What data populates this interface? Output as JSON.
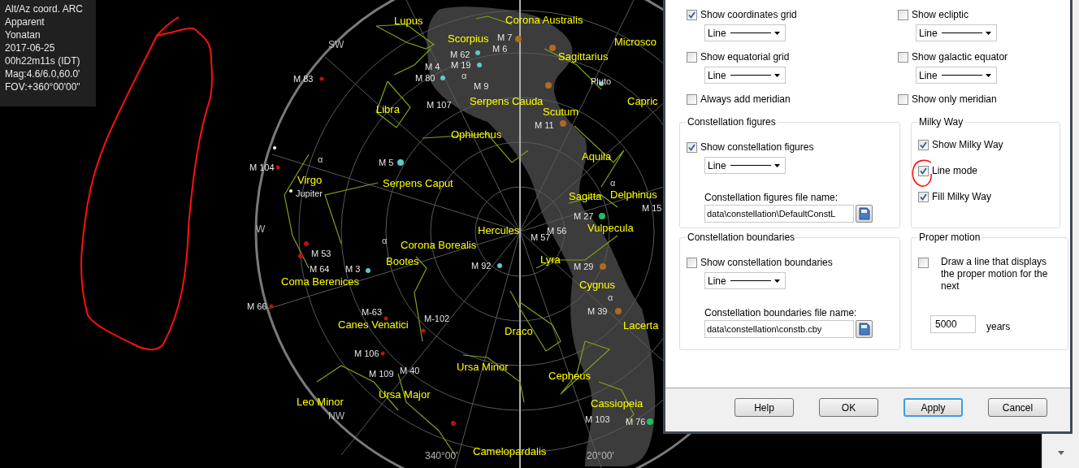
{
  "info_panel": {
    "lines": [
      "Alt/Az coord. ARC",
      "Apparent",
      "Yonatan",
      "2017-06-25",
      "00h22m11s (IDT)",
      "Mag:4.6/6.0,60.0'",
      "FOV:+360°00'00\""
    ]
  },
  "sky_map": {
    "constellation_labels": [
      "Lupus",
      "Corona Australis",
      "Scorpius",
      "Microsco",
      "Sagittarius",
      "Serpens Cauda",
      "Libra",
      "Scutum",
      "Capric",
      "Ophiuchus",
      "Aquila",
      "Virgo",
      "Serpens Caput",
      "Delphinus",
      "Sagitta",
      "Vulpecula",
      "Hercules",
      "Corona Borealis",
      "Lyra",
      "Bootes",
      "Coma Berenices",
      "Cygnus",
      "Canes Venatici",
      "Lacerta",
      "Draco",
      "Ursa Minor",
      "Cepheus",
      "Ursa Major",
      "Leo Minor",
      "Cassiopeia",
      "Camelopardalis"
    ],
    "object_labels": [
      "M 83",
      "M 7",
      "M 6",
      "M 62",
      "M 4",
      "M 19",
      "M 80",
      "M 9",
      "Pluto",
      "M 107",
      "M 11",
      "M 104",
      "M 5",
      "Jupiter",
      "M 15",
      "M 27",
      "M 56",
      "M 57",
      "M 53",
      "M 64",
      "M 3",
      "M 92",
      "M 29",
      "M 66",
      "M 39",
      "M-63",
      "M-102",
      "M 106",
      "M 109",
      "M 40",
      "M 103",
      "M 76"
    ],
    "star_labels": [
      "α",
      "α",
      "α",
      "α",
      "α"
    ],
    "direction_labels": [
      "SW",
      "W",
      "NW"
    ],
    "azimuth_labels": [
      "340°00'",
      "20°00'"
    ]
  },
  "dialog": {
    "options": [
      {
        "label": "Show coordinates grid",
        "checked": true,
        "style": "Line"
      },
      {
        "label": "Show ecliptic",
        "checked": false,
        "style": "Line"
      },
      {
        "label": "Show equatorial grid",
        "checked": false,
        "style": "Line"
      },
      {
        "label": "Show galactic equator",
        "checked": false,
        "style": "Line"
      },
      {
        "label": "Always add meridian",
        "checked": false
      },
      {
        "label": "Show only meridian",
        "checked": false
      }
    ],
    "constellation_figures": {
      "title": "Constellation figures",
      "label": "Show constellation figures",
      "checked": true,
      "style": "Line",
      "file_label": "Constellation figures file name:",
      "file_value": "data\\constellation\\DefaultConstL"
    },
    "milky_way": {
      "title": "Milky Way",
      "options": [
        {
          "label": "Show Milky Way",
          "checked": true
        },
        {
          "label": "Line mode",
          "checked": true
        },
        {
          "label": "Fill Milky Way",
          "checked": true
        }
      ]
    },
    "constellation_boundaries": {
      "title": "Constellation boundaries",
      "label": "Show constellation boundaries",
      "checked": false,
      "style": "Line",
      "file_label": "Constellation boundaries file name:",
      "file_value": "data\\constellation\\constb.cby"
    },
    "proper_motion": {
      "title": "Proper motion",
      "checked": false,
      "text": "Draw a line that displays the proper motion for the next",
      "value": "5000",
      "unit": "years"
    },
    "buttons": [
      {
        "label": "Help",
        "default": false
      },
      {
        "label": "OK",
        "default": false
      },
      {
        "label": "Apply",
        "default": true
      },
      {
        "label": "Cancel",
        "default": false
      }
    ]
  }
}
